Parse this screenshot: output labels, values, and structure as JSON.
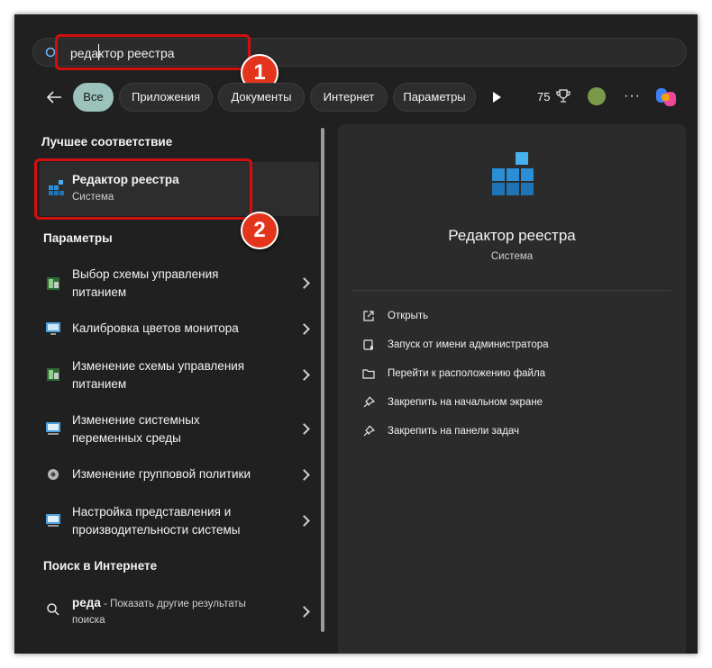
{
  "search": {
    "value": "редактор реестра"
  },
  "filters": {
    "back_label": "←",
    "chips": [
      "Все",
      "Приложения",
      "Документы",
      "Интернет",
      "Параметры"
    ],
    "points": "75"
  },
  "callouts": {
    "one": "1",
    "two": "2"
  },
  "best_match": {
    "heading": "Лучшее соответствие",
    "title": "Редактор реестра",
    "subtitle": "Система"
  },
  "settings": {
    "heading": "Параметры",
    "items": [
      {
        "line1": "Выбор схемы управления",
        "line2": "питанием",
        "icon": "power-plan-icon"
      },
      {
        "line1": "Калибровка цветов монитора",
        "line2": "",
        "icon": "monitor-icon"
      },
      {
        "line1": "Изменение схемы управления",
        "line2": "питанием",
        "icon": "power-plan-icon"
      },
      {
        "line1": "Изменение системных",
        "line2": "переменных среды",
        "icon": "system-icon"
      },
      {
        "line1": "Изменение групповой политики",
        "line2": "",
        "icon": "group-policy-icon"
      },
      {
        "line1": "Настройка представления и",
        "line2": "производительности системы",
        "icon": "system-icon"
      }
    ]
  },
  "web": {
    "heading": "Поиск в Интернете",
    "query": "реда",
    "suffix": " - Показать другие результаты",
    "suffix2": "поиска"
  },
  "details": {
    "title": "Редактор реестра",
    "subtitle": "Система",
    "actions": [
      {
        "label": "Открыть",
        "icon": "open-external-icon"
      },
      {
        "label": "Запуск от имени администратора",
        "icon": "shield-admin-icon"
      },
      {
        "label": "Перейти к расположению файла",
        "icon": "folder-icon"
      },
      {
        "label": "Закрепить на начальном экране",
        "icon": "pin-icon"
      },
      {
        "label": "Закрепить на панели задач",
        "icon": "pin-icon"
      }
    ]
  },
  "colors": {
    "accent_chip": "#9bc2bb",
    "callout_red": "#d20f0f",
    "badge": "#e3341c",
    "background": "#202020"
  }
}
